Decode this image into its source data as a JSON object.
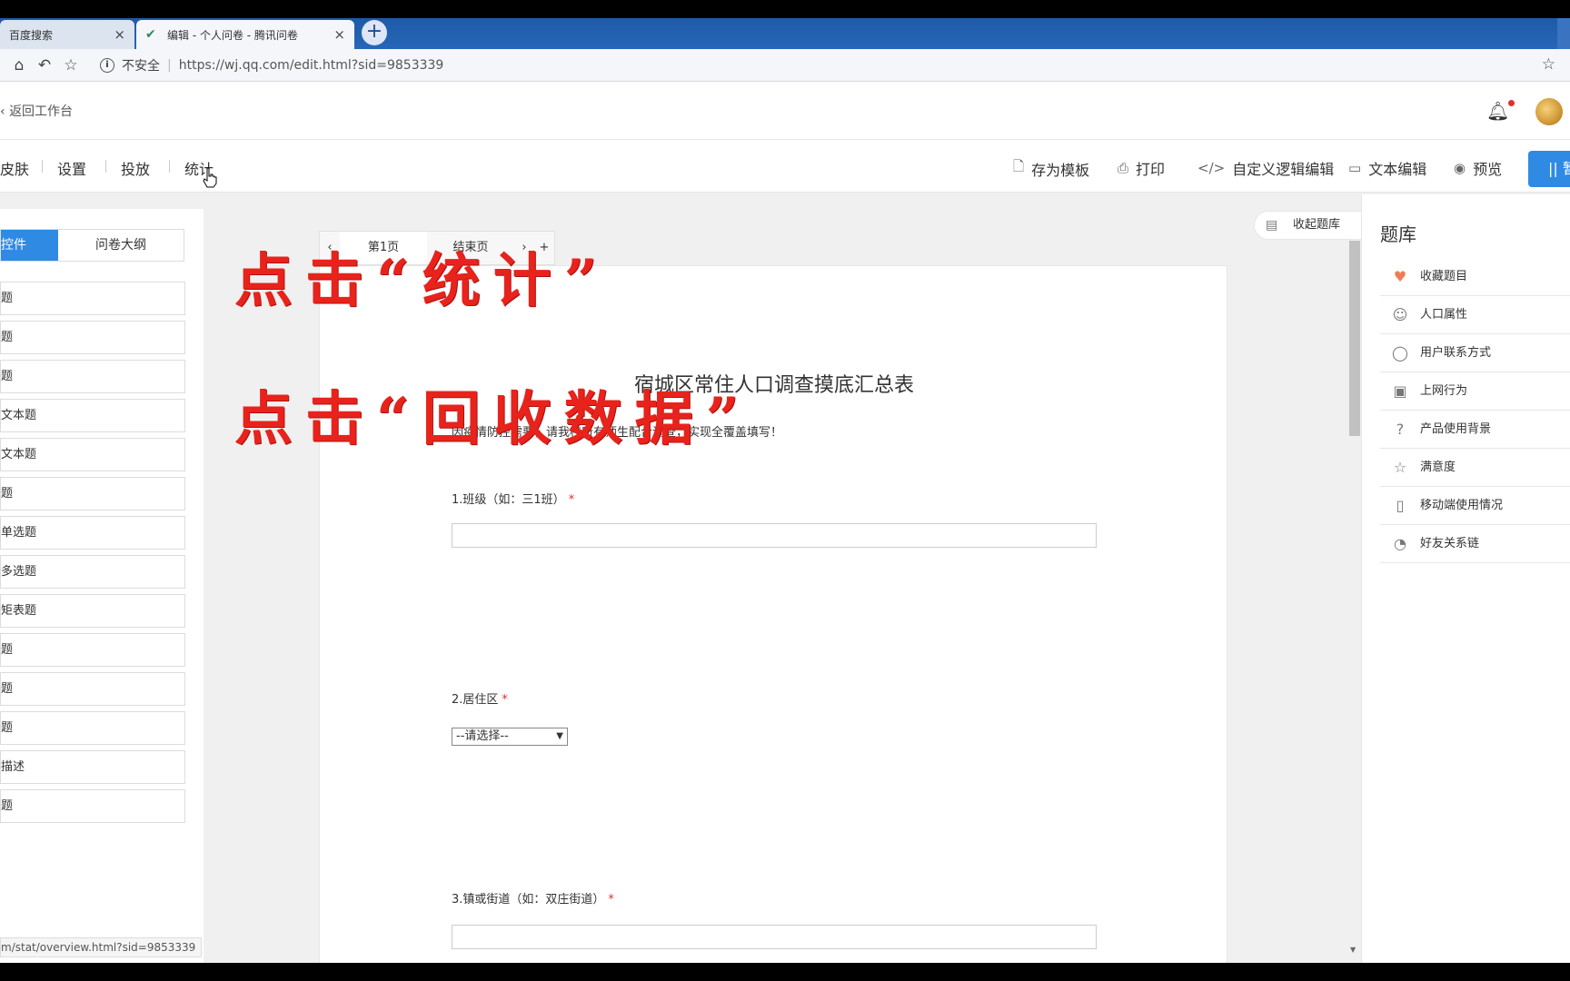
{
  "browser": {
    "tabs": [
      {
        "title": "百度搜索",
        "close": "×"
      },
      {
        "title": "编辑 - 个人问卷 - 腾讯问卷",
        "close": "×"
      }
    ],
    "new_tab": "+",
    "address": {
      "security": "不安全",
      "separator": "|",
      "url": "https://wj.qq.com/edit.html?sid=9853339"
    },
    "status_url": "m/stat/overview.html?sid=9853339"
  },
  "header": {
    "back": "返回工作台"
  },
  "toolbar": {
    "left": [
      "皮肤",
      "设置",
      "投放",
      "统计"
    ],
    "right": [
      {
        "icon": "document-icon",
        "glyph": "🗋",
        "label": "存为模板"
      },
      {
        "icon": "print-icon",
        "glyph": "⎙",
        "label": "打印"
      },
      {
        "icon": "code-icon",
        "glyph": "</>",
        "label": "自定义逻辑编辑"
      },
      {
        "icon": "text-edit-icon",
        "glyph": "▭",
        "label": "文本编辑"
      },
      {
        "icon": "eye-icon",
        "glyph": "◉",
        "label": "预览"
      }
    ],
    "publish_label": "|| 暂"
  },
  "left_panel": {
    "tabs": [
      "控件",
      "问卷大纲"
    ],
    "controls": [
      "题",
      "题",
      "题",
      "文本题",
      "文本题",
      "题",
      "单选题",
      "多选题",
      "矩表题",
      "题",
      "题",
      "题",
      "描述",
      "题"
    ]
  },
  "page_tabs": {
    "prev": "‹",
    "items": [
      "第1页",
      "结束页"
    ],
    "next": "›",
    "add": "+"
  },
  "form": {
    "title": "宿城区常住人口调查摸底汇总表",
    "description": "因疫情防控需要，请我校所有师生配合调查，实现全覆盖填写！",
    "questions": [
      {
        "label": "1.班级（如：三1班）",
        "required": "*"
      },
      {
        "label": "2.居住区",
        "required": "*",
        "select": "--请选择--"
      },
      {
        "label": "3.镇或街道（如：双庄街道）",
        "required": "*"
      }
    ]
  },
  "right_panel": {
    "collapse_label": "收起题库",
    "title": "题库",
    "items": [
      {
        "icon": "heart-icon",
        "glyph": "♥",
        "label": "收藏题目"
      },
      {
        "icon": "person-icon",
        "glyph": "☺",
        "label": "人口属性"
      },
      {
        "icon": "chat-icon",
        "glyph": "◯",
        "label": "用户联系方式"
      },
      {
        "icon": "window-icon",
        "glyph": "▣",
        "label": "上网行为"
      },
      {
        "icon": "question-icon",
        "glyph": "?",
        "label": "产品使用背景"
      },
      {
        "icon": "star-icon",
        "glyph": "☆",
        "label": "满意度"
      },
      {
        "icon": "mobile-icon",
        "glyph": "▯",
        "label": "移动端使用情况"
      },
      {
        "icon": "link-icon",
        "glyph": "◔",
        "label": "好友关系链"
      }
    ]
  },
  "annotations": [
    "点击“统计”",
    "点击“回收数据”"
  ],
  "colors": {
    "accent": "#2f8ae4",
    "annotation": "#e8231c",
    "required": "#e0302b"
  }
}
